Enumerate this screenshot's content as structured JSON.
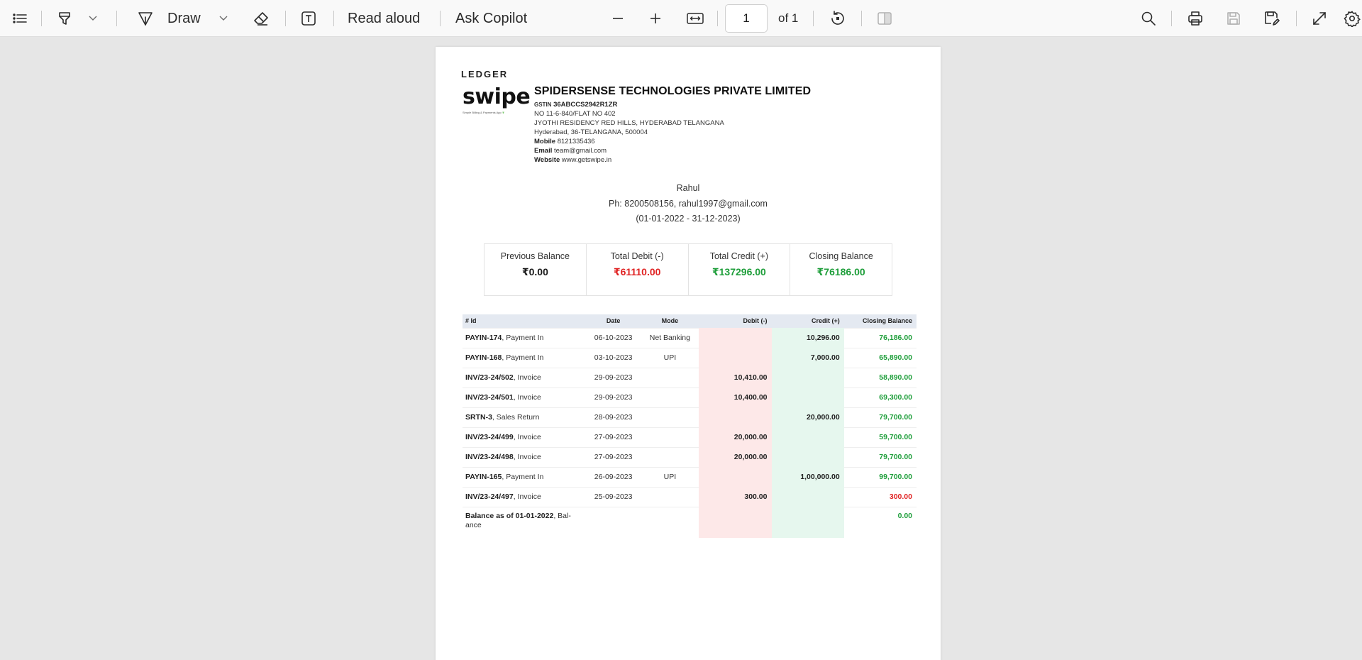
{
  "toolbar": {
    "draw_label": "Draw",
    "read_aloud_label": "Read aloud",
    "ask_copilot_label": "Ask Copilot",
    "page_number": "1",
    "page_count_label": "of 1",
    "icons": [
      "contents-icon",
      "highlight-icon",
      "chevron-down-icon",
      "draw-icon",
      "eraser-icon",
      "text-box-icon",
      "zoom-out-icon",
      "zoom-in-icon",
      "fit-width-icon",
      "rotate-icon",
      "page-view-icon",
      "search-icon",
      "print-icon",
      "save-icon",
      "save-as-icon",
      "fullscreen-icon",
      "settings-icon"
    ]
  },
  "document": {
    "heading": "LEDGER",
    "logo": {
      "word": "swipe",
      "tagline": "Simple Billing & Payments App"
    },
    "company": {
      "name": "SPIDERSENSE TECHNOLOGIES PRIVATE LIMITED",
      "gstin_label": "GSTIN",
      "gstin": "36ABCCS2942R1ZR",
      "address1": "NO 11-6-840/FLAT NO 402",
      "address2": "JYOTHI RESIDENCY RED HILLS, HYDERABAD TELANGANA",
      "address3": "Hyderabad, 36-TELANGANA, 500004",
      "mobile_label": "Mobile",
      "mobile": "8121335436",
      "email_label": "Email",
      "email": "team@gmail.com",
      "website_label": "Website",
      "website": "www.getswipe.in"
    },
    "party": {
      "name": "Rahul",
      "contact": "Ph: 8200508156, rahul1997@gmail.com",
      "period": "(01-01-2022 - 31-12-2023)"
    },
    "summary": [
      {
        "label": "Previous Balance",
        "value": "₹0.00",
        "color": "#1a1a1a"
      },
      {
        "label": "Total Debit (-)",
        "value": "₹61110.00",
        "color": "#e02424"
      },
      {
        "label": "Total Credit (+)",
        "value": "₹137296.00",
        "color": "#1e9e3a"
      },
      {
        "label": "Closing Balance",
        "value": "₹76186.00",
        "color": "#1e9e3a"
      }
    ],
    "table": {
      "headers": {
        "id": "# Id",
        "date": "Date",
        "mode": "Mode",
        "debit": "Debit (-)",
        "credit": "Credit (+)",
        "balance": "Closing Balance"
      },
      "rows": [
        {
          "id": "PAYIN-174",
          "type": ", Payment In",
          "date": "06-10-2023",
          "mode": "Net Banking",
          "debit": "",
          "credit": "10,296.00",
          "balance": "76,186.00",
          "balance_color": "#1e9e3a"
        },
        {
          "id": "PAYIN-168",
          "type": ", Payment In",
          "date": "03-10-2023",
          "mode": "UPI",
          "debit": "",
          "credit": "7,000.00",
          "balance": "65,890.00",
          "balance_color": "#1e9e3a"
        },
        {
          "id": "INV/23-24/502",
          "type": ", Invoice",
          "date": "29-09-2023",
          "mode": "",
          "debit": "10,410.00",
          "credit": "",
          "balance": "58,890.00",
          "balance_color": "#1e9e3a"
        },
        {
          "id": "INV/23-24/501",
          "type": ", Invoice",
          "date": "29-09-2023",
          "mode": "",
          "debit": "10,400.00",
          "credit": "",
          "balance": "69,300.00",
          "balance_color": "#1e9e3a"
        },
        {
          "id": "SRTN-3",
          "type": ", Sales Return",
          "date": "28-09-2023",
          "mode": "",
          "debit": "",
          "credit": "20,000.00",
          "balance": "79,700.00",
          "balance_color": "#1e9e3a"
        },
        {
          "id": "INV/23-24/499",
          "type": ", Invoice",
          "date": "27-09-2023",
          "mode": "",
          "debit": "20,000.00",
          "credit": "",
          "balance": "59,700.00",
          "balance_color": "#1e9e3a"
        },
        {
          "id": "INV/23-24/498",
          "type": ", Invoice",
          "date": "27-09-2023",
          "mode": "",
          "debit": "20,000.00",
          "credit": "",
          "balance": "79,700.00",
          "balance_color": "#1e9e3a"
        },
        {
          "id": "PAYIN-165",
          "type": ", Payment In",
          "date": "26-09-2023",
          "mode": "UPI",
          "debit": "",
          "credit": "1,00,000.00",
          "balance": "99,700.00",
          "balance_color": "#1e9e3a"
        },
        {
          "id": "INV/23-24/497",
          "type": ", Invoice",
          "date": "25-09-2023",
          "mode": "",
          "debit": "300.00",
          "credit": "",
          "balance": "300.00",
          "balance_color": "#e02424"
        }
      ],
      "opening_row": {
        "id": "Balance as of 01-01-2022",
        "type": ", Bal-",
        "type2": "ance",
        "balance": "0.00",
        "balance_color": "#1e9e3a"
      }
    }
  }
}
